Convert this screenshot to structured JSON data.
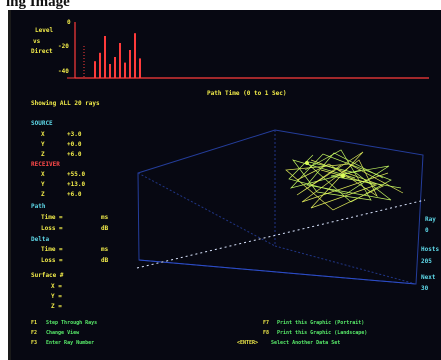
{
  "page": {
    "title": "ing Image"
  },
  "level_panel": {
    "label_level": "Level",
    "label_vs": "vs",
    "label_direct": "Direct",
    "ticks": {
      "zero": "0",
      "minus20": "-20",
      "minus40": "-40"
    },
    "accent_red": "#ff3b3b",
    "impulse_cluster_values": [
      -12,
      -18,
      -30,
      -10,
      -15,
      -25,
      -11,
      -20,
      -32,
      -14
    ]
  },
  "status": {
    "showing": "Showing ALL 20 rays",
    "path_time_title": "Path Time (0 to 1 Sec)"
  },
  "source": {
    "header": "SOURCE",
    "x_label": "X",
    "x_value": "+3.0",
    "y_label": "Y",
    "y_value": "+0.0",
    "z_label": "Z",
    "z_value": "+6.0"
  },
  "receiver": {
    "header": "RECEIVER",
    "x_label": "X",
    "x_value": "+55.0",
    "y_label": "Y",
    "y_value": "+13.0",
    "z_label": "Z",
    "z_value": "+6.0"
  },
  "path": {
    "header": "Path",
    "time_label": "Time =",
    "time_value": "ms",
    "loss_label": "Loss =",
    "loss_value": "dB"
  },
  "delta": {
    "header": "Delta",
    "time_label": "Time =",
    "time_value": "ms",
    "loss_label": "Loss =",
    "loss_value": "dB"
  },
  "surface": {
    "header": "Surface #",
    "x_label": "X =",
    "y_label": "Y =",
    "z_label": "Z ="
  },
  "right_panel": {
    "ray_label": "Ray",
    "ray_value": "0",
    "hosts_label": "Hosts",
    "hosts_value": "205",
    "next_label": "Next",
    "next_value": "30"
  },
  "footer": {
    "f1": "F1",
    "f1_text": "Step Through Rays",
    "f2": "F2",
    "f2_text": "Change View",
    "f3": "F3",
    "f3_text": "Enter Ray Number",
    "f7": "F7",
    "f7_text": "Print this Graphic (Portrait)",
    "f8": "F8",
    "f8_text": "Print this Graphic (Landscape)",
    "enter": "<ENTER>",
    "enter_text": "Select Another Data Set"
  }
}
